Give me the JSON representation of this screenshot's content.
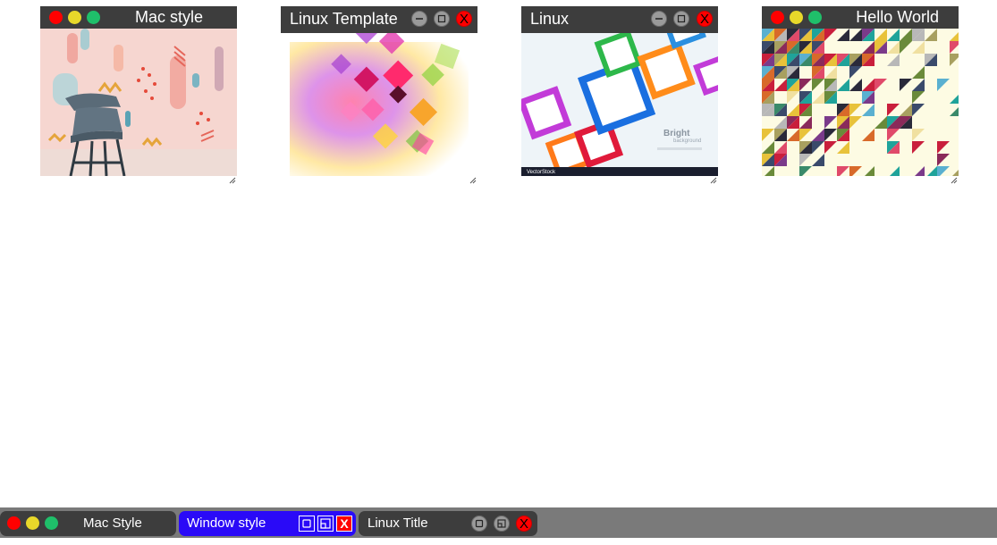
{
  "windows": [
    {
      "title": "Mac style",
      "style": "mac",
      "image": "chair-wall-pastel"
    },
    {
      "title": "Linux Template",
      "style": "linux",
      "image": "colorful-squares"
    },
    {
      "title": "Linux",
      "style": "linux",
      "image": "bright-squares-background",
      "image_text": {
        "main": "Bright",
        "sub": "background",
        "corner": "VectorStock"
      }
    },
    {
      "title": "Hello World",
      "style": "mac",
      "image": "triangle-mosaic"
    }
  ],
  "linux_buttons": {
    "minimize": "minimize-icon",
    "maximize": "maximize-icon",
    "close": "X"
  },
  "taskbar": {
    "items": [
      {
        "label": "Mac Style",
        "style": "mac"
      },
      {
        "label": "Window style",
        "style": "windows",
        "close": "X"
      },
      {
        "label": "Linux Title",
        "style": "linux",
        "close": "X"
      }
    ]
  },
  "colors": {
    "titlebar": "#3d3d3d",
    "taskbar": "#7a7a7a",
    "windows_task": "#2a0af7",
    "mac_red": "#ff0000",
    "mac_yellow": "#e8d82a",
    "mac_green": "#1fbf6a",
    "close_red": "#ff0000"
  }
}
